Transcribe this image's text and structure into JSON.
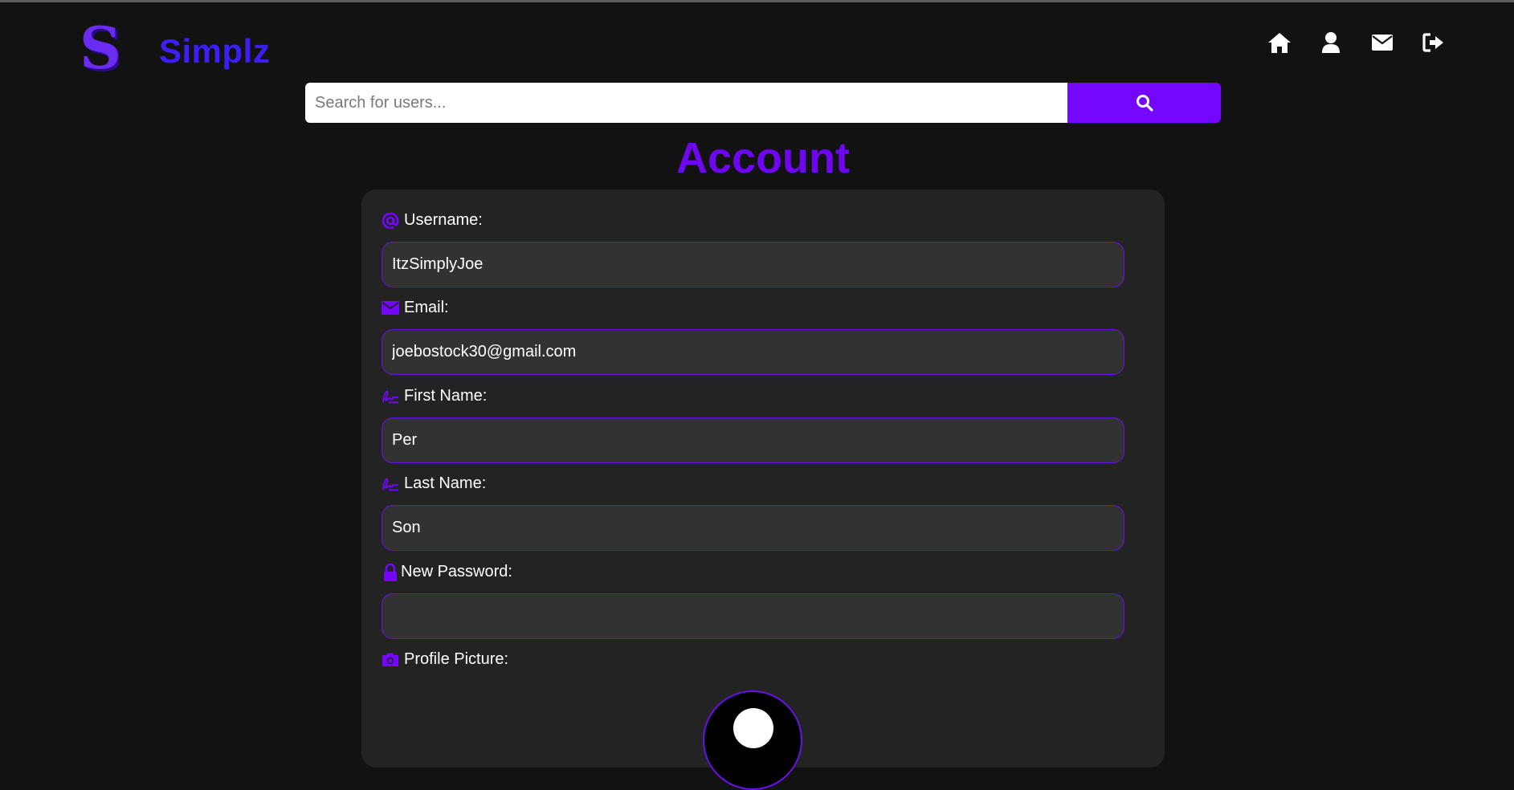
{
  "app": {
    "brand": "Simplz"
  },
  "colors": {
    "accent": "#7307ff",
    "title": "#6f06f2",
    "brand": "#3b1ff5",
    "background": "#121212",
    "card": "#232323"
  },
  "nav": {
    "items": [
      {
        "icon": "home-icon"
      },
      {
        "icon": "user-icon"
      },
      {
        "icon": "envelope-icon"
      },
      {
        "icon": "sign-out-icon"
      }
    ]
  },
  "search": {
    "placeholder": "Search for users...",
    "value": ""
  },
  "page": {
    "title": "Account"
  },
  "form": {
    "username": {
      "label": "Username:",
      "value": "ItzSimplyJoe",
      "icon": "at-icon"
    },
    "email": {
      "label": "Email:",
      "value": "joebostock30@gmail.com",
      "icon": "envelope-icon"
    },
    "first_name": {
      "label": "First Name:",
      "value": "Per",
      "icon": "signature-icon"
    },
    "last_name": {
      "label": "Last Name:",
      "value": "Son",
      "icon": "signature-icon"
    },
    "new_password": {
      "label": "New Password:",
      "value": "",
      "icon": "lock-icon"
    },
    "profile_picture": {
      "label": "Profile Picture:",
      "icon": "camera-icon"
    }
  }
}
